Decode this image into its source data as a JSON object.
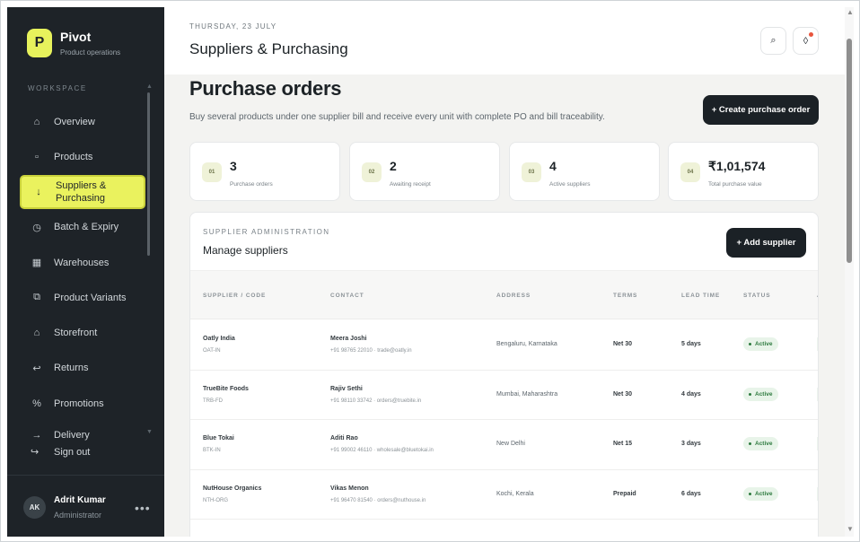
{
  "sidebar": {
    "brand": {
      "logo_letter": "P",
      "name": "Pivot",
      "subtitle": "Product operations"
    },
    "section_label": "WORKSPACE",
    "items": [
      {
        "label": "Overview",
        "icon": "home-icon",
        "glyph": "⌂"
      },
      {
        "label": "Products",
        "icon": "box-icon",
        "glyph": "▫"
      },
      {
        "label": "Suppliers & Purchasing",
        "icon": "download-arrow-icon",
        "glyph": "↓",
        "active": true
      },
      {
        "label": "Batch & Expiry",
        "icon": "clock-icon",
        "glyph": "◷"
      },
      {
        "label": "Warehouses",
        "icon": "warehouse-grid-icon",
        "glyph": "▦"
      },
      {
        "label": "Product Variants",
        "icon": "layers-icon",
        "glyph": "⧉"
      },
      {
        "label": "Storefront",
        "icon": "storefront-icon",
        "glyph": "⌂"
      },
      {
        "label": "Returns",
        "icon": "return-arrow-icon",
        "glyph": "↩"
      },
      {
        "label": "Promotions",
        "icon": "percent-icon",
        "glyph": "%"
      },
      {
        "label": "Delivery",
        "icon": "arrow-right-icon",
        "glyph": "→"
      }
    ],
    "sign_out": {
      "label": "Sign out",
      "glyph": "↪"
    },
    "user": {
      "initials": "AK",
      "name": "Adrit Kumar",
      "role": "Administrator"
    }
  },
  "header": {
    "date": "THURSDAY, 23 JULY",
    "title": "Suppliers & Purchasing",
    "search_glyph": "⌕",
    "notify_glyph": "◊"
  },
  "main": {
    "heading": "Purchase orders",
    "subtitle": "Buy several products under one supplier bill and receive every unit with complete PO and bill traceability.",
    "create_button": "+ Create purchase order"
  },
  "stats": [
    {
      "badge": "01",
      "value": "3",
      "label": "Purchase orders"
    },
    {
      "badge": "02",
      "value": "2",
      "label": "Awaiting receipt"
    },
    {
      "badge": "03",
      "value": "4",
      "label": "Active suppliers"
    },
    {
      "badge": "04",
      "value": "₹1,01,574",
      "label": "Total purchase value"
    }
  ],
  "suppliers": {
    "kicker": "SUPPLIER ADMINISTRATION",
    "title": "Manage suppliers",
    "add_button": "+ Add supplier",
    "columns": [
      "SUPPLIER / CODE",
      "CONTACT",
      "ADDRESS",
      "TERMS",
      "LEAD TIME",
      "STATUS",
      "A"
    ],
    "rows": [
      {
        "name": "Oatly India",
        "code": "OAT-IN",
        "contact": "Meera Joshi",
        "contact_detail": "+91 98765 22010 · trade@oatly.in",
        "address": "Bengaluru, Karnataka",
        "terms": "Net 30",
        "lead_time": "5 days",
        "status": "Active"
      },
      {
        "name": "TrueBite Foods",
        "code": "TRB-FD",
        "contact": "Rajiv Sethi",
        "contact_detail": "+91 98110 33742 · orders@truebite.in",
        "address": "Mumbai, Maharashtra",
        "terms": "Net 30",
        "lead_time": "4 days",
        "status": "Active"
      },
      {
        "name": "Blue Tokai",
        "code": "BTK-IN",
        "contact": "Aditi Rao",
        "contact_detail": "+91 99002 46110 · wholesale@bluetokai.in",
        "address": "New Delhi",
        "terms": "Net 15",
        "lead_time": "3 days",
        "status": "Active"
      },
      {
        "name": "NutHouse Organics",
        "code": "NTH-ORG",
        "contact": "Vikas Menon",
        "contact_detail": "+91 96470 81540 · orders@nuthouse.in",
        "address": "Kochi, Kerala",
        "terms": "Prepaid",
        "lead_time": "6 days",
        "status": "Active"
      }
    ]
  }
}
